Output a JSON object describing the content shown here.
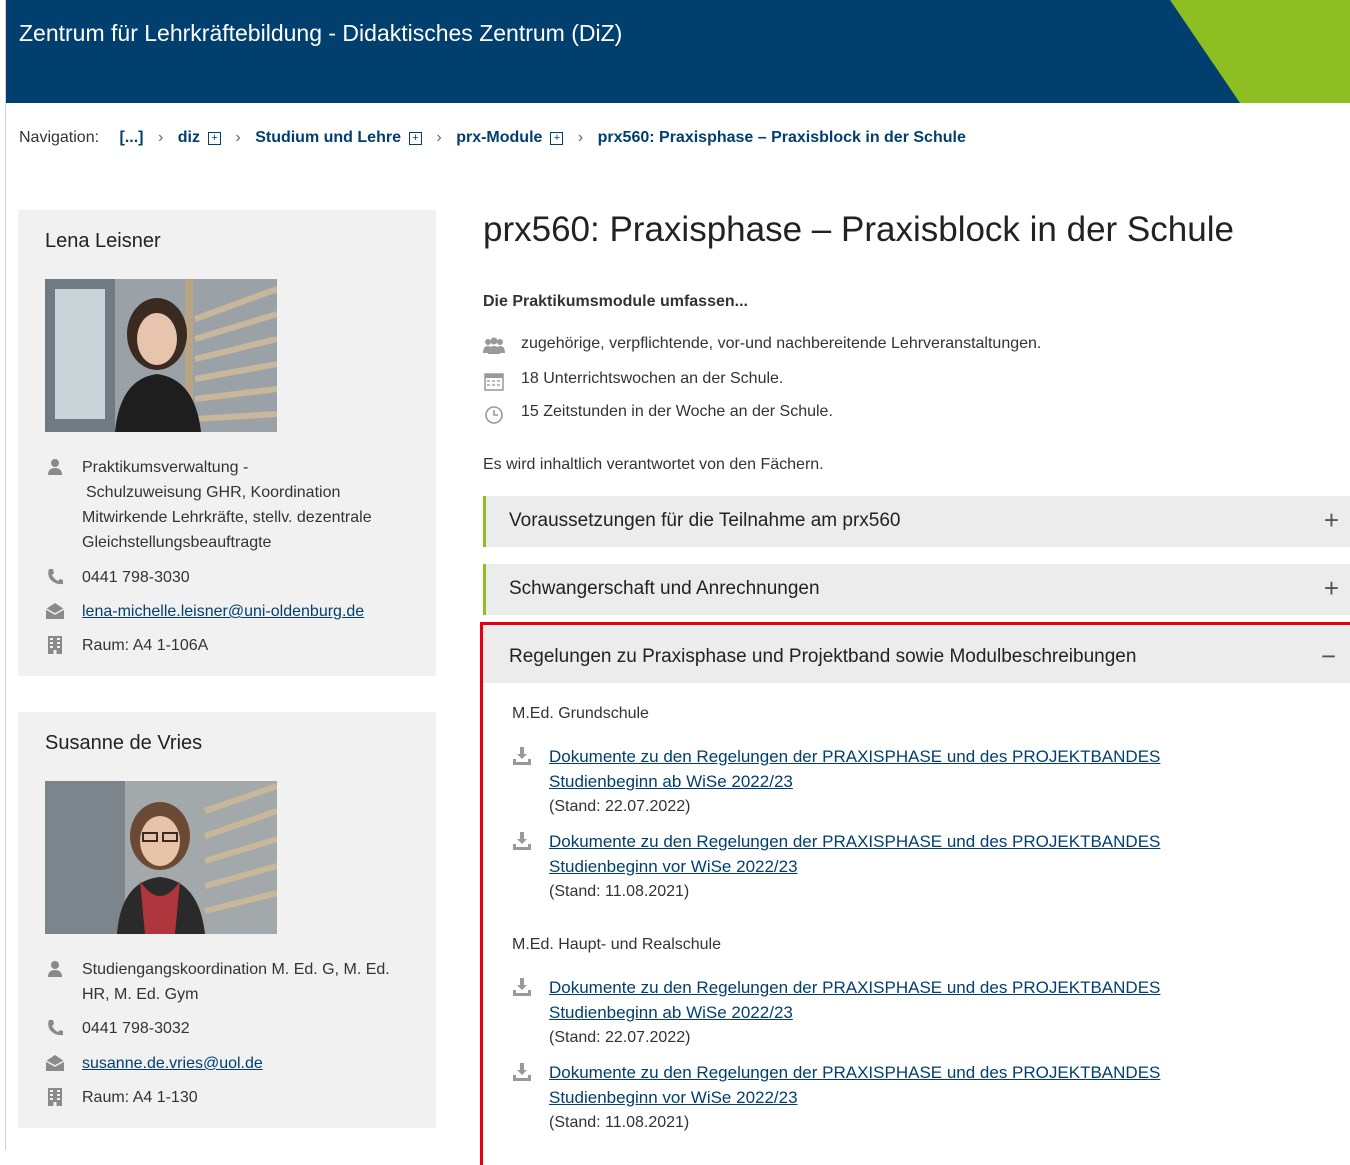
{
  "header": {
    "title": "Zentrum für Lehrkräftebildung - Didaktisches Zentrum (DiZ)"
  },
  "breadcrumb": {
    "label": "Navigation:",
    "items": [
      "[...]",
      "diz",
      "Studium und Lehre",
      "prx-Module",
      "prx560: Praxisphase – Praxisblock in der Schule"
    ]
  },
  "contacts": [
    {
      "name": "Lena Leisner",
      "role_lines": [
        "Praktikumsverwaltung -",
        "Schulzuweisung GHR, Koordination",
        "Mitwirkende Lehrkräfte, stellv. dezentrale",
        "Gleichstellungsbeauftragte"
      ],
      "phone": "0441 798-3030",
      "email": "lena-michelle.leisner@uni-oldenburg.de",
      "room": "Raum: A4 1-106A"
    },
    {
      "name": "Susanne de Vries",
      "role_lines": [
        "Studiengangskoordination M. Ed. G, M. Ed.",
        "HR, M. Ed. Gym"
      ],
      "phone": "0441 798-3032",
      "email": "susanne.de.vries@uol.de",
      "room": "Raum: A4 1-130"
    }
  ],
  "main": {
    "title": "prx560: Praxisphase – Praxisblock in der Schule",
    "intro": "Die Praktikumsmodule umfassen...",
    "bullets": [
      {
        "icon": "group-icon",
        "text": "zugehörige, verpflichtende, vor-und nachbereitende Lehrveranstaltungen."
      },
      {
        "icon": "calendar-icon",
        "text": "18 Unterrichtswochen an der Schule."
      },
      {
        "icon": "clock-icon",
        "text": "15 Zeitstunden in der Woche an der Schule."
      }
    ],
    "responsibility": "Es wird inhaltlich verantwortet von den Fächern.",
    "accordion": [
      {
        "title": "Voraussetzungen für die Teilnahme am prx560",
        "toggle": "+"
      },
      {
        "title": "Schwangerschaft und Anrechnungen",
        "toggle": "+"
      },
      {
        "title": "Regelungen zu Praxisphase und Projektband sowie Modulbeschreibungen",
        "toggle": "−"
      }
    ],
    "sections": [
      {
        "heading": "M.Ed. Grundschule",
        "docs": [
          {
            "line1": "Dokumente zu den Regelungen der PRAXISPHASE und des PROJEKTBANDES",
            "line2": "Studienbeginn ab WiSe 2022/23",
            "stand": "(Stand: 22.07.2022)"
          },
          {
            "line1": "Dokumente zu den Regelungen der PRAXISPHASE und des PROJEKTBANDES",
            "line2": "Studienbeginn vor WiSe 2022/23",
            "stand": "(Stand: 11.08.2021)"
          }
        ]
      },
      {
        "heading": "M.Ed. Haupt- und Realschule",
        "docs": [
          {
            "line1": "Dokumente zu den Regelungen der PRAXISPHASE und des PROJEKTBANDES",
            "line2": "Studienbeginn ab WiSe 2022/23",
            "stand": "(Stand: 22.07.2022)"
          },
          {
            "line1": "Dokumente zu den Regelungen der PRAXISPHASE und des PROJEKTBANDES",
            "line2": "Studienbeginn vor WiSe 2022/23",
            "stand": "(Stand: 11.08.2021)"
          }
        ]
      }
    ]
  },
  "colors": {
    "header_bg": "#003f6e",
    "accent_green": "#8dbe22",
    "link": "#003f6e",
    "highlight_border": "#e3000f"
  }
}
